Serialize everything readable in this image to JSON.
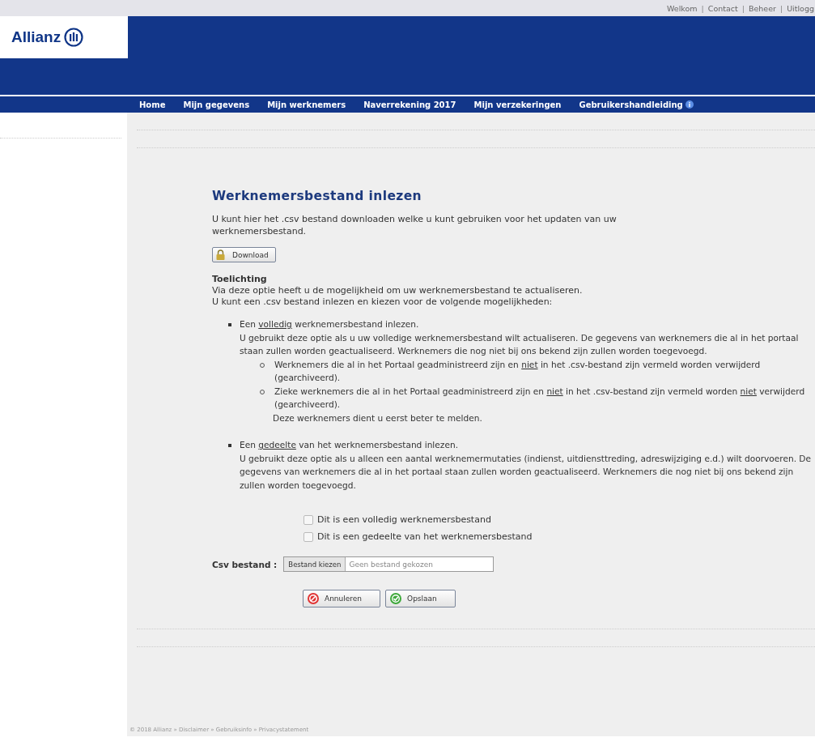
{
  "top_links": [
    "Welkom",
    "Contact",
    "Beheer",
    "Uitlogg"
  ],
  "top_links_separator": "|",
  "logo": {
    "text": "Allianz"
  },
  "nav": [
    {
      "label": "Home"
    },
    {
      "label": "Mijn gegevens"
    },
    {
      "label": "Mijn werknemers"
    },
    {
      "label": "Naverrekening 2017"
    },
    {
      "label": "Mijn verzekeringen"
    },
    {
      "label": "Gebruikershandleiding",
      "info": true
    }
  ],
  "page": {
    "title": "Werknemersbestand inlezen",
    "intro": "U kunt hier het .csv bestand downloaden welke u kunt gebruiken voor het updaten van uw werknemersbestand.",
    "download_button": "Download",
    "explanation_heading": "Toelichting",
    "explanation_lines": [
      "Via deze optie heeft u de mogelijkheid om uw werknemersbestand te actualiseren.",
      "U kunt een  .csv bestand inlezen en kiezen voor de volgende mogelijkheden:"
    ],
    "options": [
      {
        "heading": [
          {
            "text": "Een "
          },
          {
            "text": "volledig",
            "underline": true
          },
          {
            "text": " werknemersbestand inlezen."
          }
        ],
        "text": "U gebruikt deze optie als u uw volledige werknemersbestand wilt actualiseren. De gegevens van werknemers die al in het portaal staan zullen worden geactualiseerd. Werknemers die nog niet bij ons bekend zijn zullen worden toegevoegd.",
        "subitems": [
          [
            {
              "text": "Werknemers die al in het Portaal geadministreerd zijn en "
            },
            {
              "text": "niet",
              "underline": true
            },
            {
              "text": " in het .csv-bestand zijn vermeld worden verwijderd (gearchiveerd)."
            }
          ],
          [
            {
              "text": "Zieke werknemers die al in het Portaal geadministreerd zijn en "
            },
            {
              "text": "niet",
              "underline": true
            },
            {
              "text": " in het .csv-bestand zijn vermeld worden "
            },
            {
              "text": "niet",
              "underline": true
            },
            {
              "text": " verwijderd (gearchiveerd)."
            }
          ]
        ],
        "subnote": "Deze werknemers dient u eerst beter te melden."
      },
      {
        "heading": [
          {
            "text": "Een "
          },
          {
            "text": "gedeelte",
            "underline": true
          },
          {
            "text": " van het werknemersbestand inlezen."
          }
        ],
        "text": "U gebruikt deze optie als u alleen een aantal werknemermutaties (indienst, uitdiensttreding, adreswijziging e.d.) wilt doorvoeren. De gegevens van werknemers die al in het portaal staan zullen worden geactualiseerd. Werknemers die nog niet bij ons bekend zijn zullen worden toegevoegd."
      }
    ],
    "checkboxes": [
      {
        "label": "Dit is een volledig werknemersbestand",
        "checked": false
      },
      {
        "label": "Dit is een gedeelte van het werknemersbestand",
        "checked": false
      }
    ],
    "file_field": {
      "label": "Csv bestand :",
      "button": "Bestand kiezen",
      "value": "Geen bestand gekozen"
    },
    "buttons": [
      {
        "label": "Annuleren",
        "kind": "cancel"
      },
      {
        "label": "Opslaan",
        "kind": "save"
      }
    ]
  },
  "footer": "© 2018 Allianz » Disclaimer » Gebruiksinfo » Privacystatement"
}
